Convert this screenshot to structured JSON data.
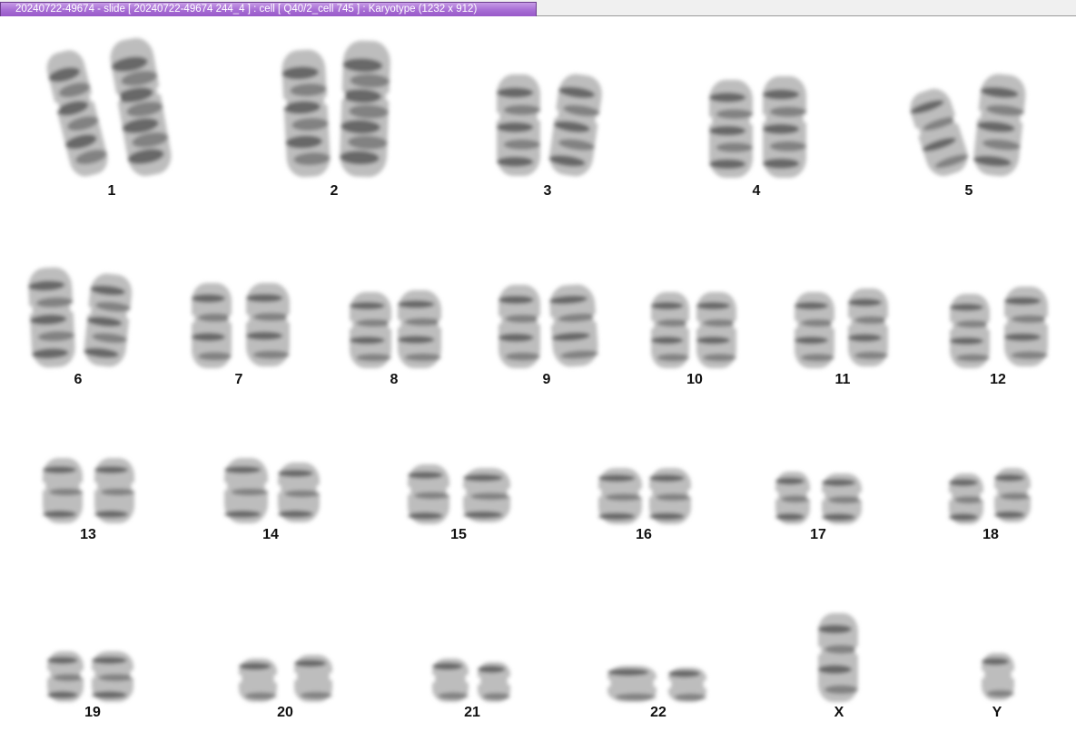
{
  "window": {
    "title": "20240722-49674 - slide [ 20240722-49674 244_4 ] : cell [ Q40/2_cell 745 ] : Karyotype  (1232 x 912)"
  },
  "karyotype": {
    "labels": {
      "c1": "1",
      "c2": "2",
      "c3": "3",
      "c4": "4",
      "c5": "5",
      "c6": "6",
      "c7": "7",
      "c8": "8",
      "c9": "9",
      "c10": "10",
      "c11": "11",
      "c12": "12",
      "c13": "13",
      "c14": "14",
      "c15": "15",
      "c16": "16",
      "c17": "17",
      "c18": "18",
      "c19": "19",
      "c20": "20",
      "c21": "21",
      "c22": "22",
      "cX": "X",
      "cY": "Y"
    }
  },
  "colors": {
    "chromosome_light": "#bdbdbd",
    "chromosome_dark": "#3a3a3a",
    "title_bar": "#a970d6"
  }
}
